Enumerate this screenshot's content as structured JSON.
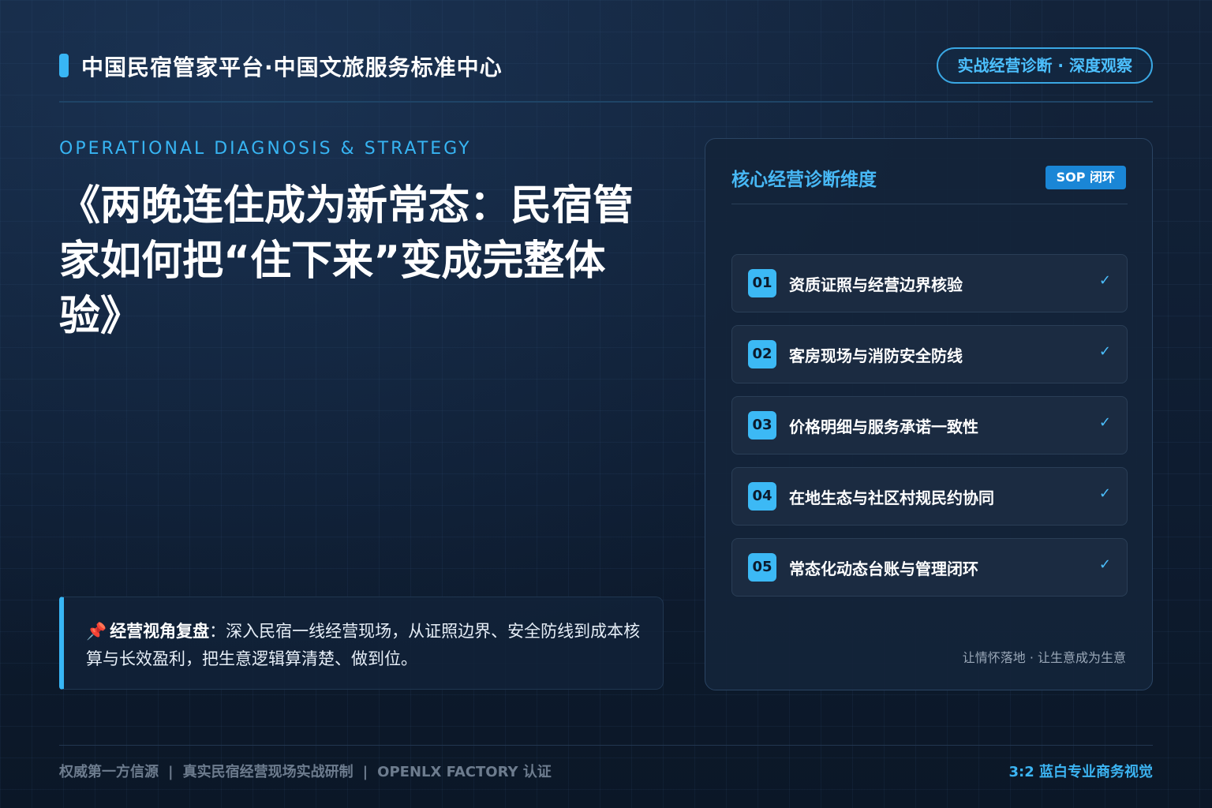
{
  "header": {
    "title": "中国民宿管家平台·中国文旅服务标准中心",
    "badge": "实战经营诊断 · 深度观察"
  },
  "eyebrow": "OPERATIONAL DIAGNOSIS & STRATEGY",
  "main_title": "《两晚连住成为新常态：民宿管家如何把“住下来”变成完整体验》",
  "quote": {
    "icon": "pushpin-icon",
    "label": "经营视角复盘",
    "text": "：深入民宿一线经营现场，从证照边界、安全防线到成本核算与长效盈利，把生意逻辑算清楚、做到位。"
  },
  "panel": {
    "title": "核心经营诊断维度",
    "tag": "SOP 闭环",
    "items": [
      {
        "num": "01",
        "label": "资质证照与经营边界核验",
        "check": "✓"
      },
      {
        "num": "02",
        "label": "客房现场与消防安全防线",
        "check": "✓"
      },
      {
        "num": "03",
        "label": "价格明细与服务承诺一致性",
        "check": "✓"
      },
      {
        "num": "04",
        "label": "在地生态与社区村规民约协同",
        "check": "✓"
      },
      {
        "num": "05",
        "label": "常态化动态台账与管理闭环",
        "check": "✓"
      }
    ],
    "slogan": "让情怀落地 · 让生意成为生意"
  },
  "footer": {
    "items": [
      "权威第一方信源",
      "真实民宿经营现场实战研制",
      "OPENLX FACTORY 认证"
    ],
    "separator": "|",
    "right": "3:2 蓝白专业商务视觉"
  },
  "colors": {
    "accent": "#38b6f5",
    "background": "#0d1b2e",
    "panel": "#14243a"
  }
}
